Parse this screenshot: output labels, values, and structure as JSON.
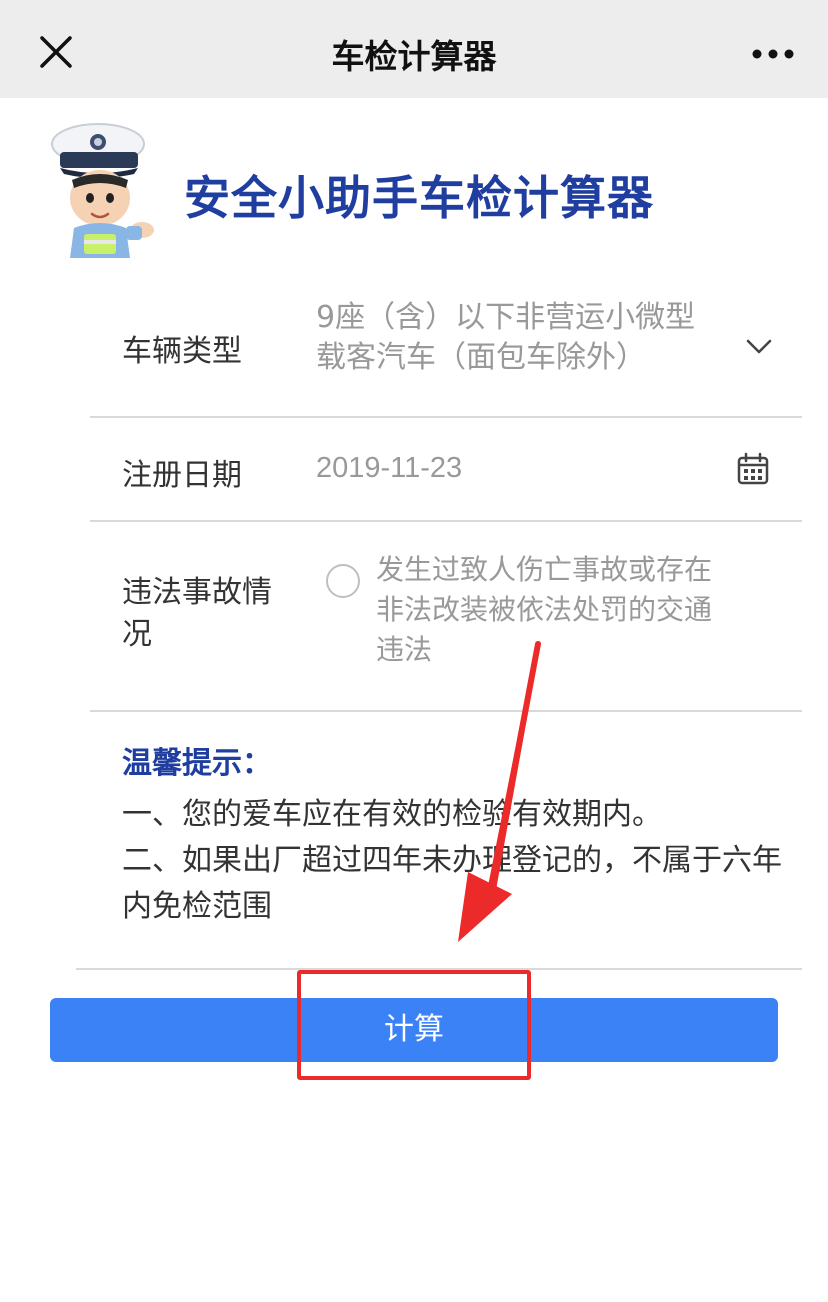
{
  "topbar": {
    "title": "车检计算器",
    "close_icon": "close-icon",
    "more_icon": "more-icon"
  },
  "header": {
    "title": "安全小助手车检计算器",
    "mascot": "police-mascot"
  },
  "form": {
    "vehicle_type": {
      "label": "车辆类型",
      "value_line1": "9座（含）以下非营运小微型",
      "value_line2": "载客汽车（面包车除外）",
      "icon": "chevron-down-icon"
    },
    "register_date": {
      "label": "注册日期",
      "value": "2019-11-23",
      "icon": "calendar-icon"
    },
    "violation": {
      "label": "违法事故情况",
      "option_text": "发生过致人伤亡事故或存在非法改装被依法处罚的交通违法",
      "checked": false
    }
  },
  "tips": {
    "title": "温馨提示：",
    "items": [
      "一、您的爱车应在有效的检验有效期内。",
      "二、如果出厂超过四年未办理登记的，不属于六年内免检范围"
    ]
  },
  "calculate_button": {
    "label": "计算"
  },
  "colors": {
    "accent": "#3b82f6",
    "brand": "#1f3ea0",
    "annotation": "#ec2a2a",
    "topbar_bg": "#ededed"
  }
}
